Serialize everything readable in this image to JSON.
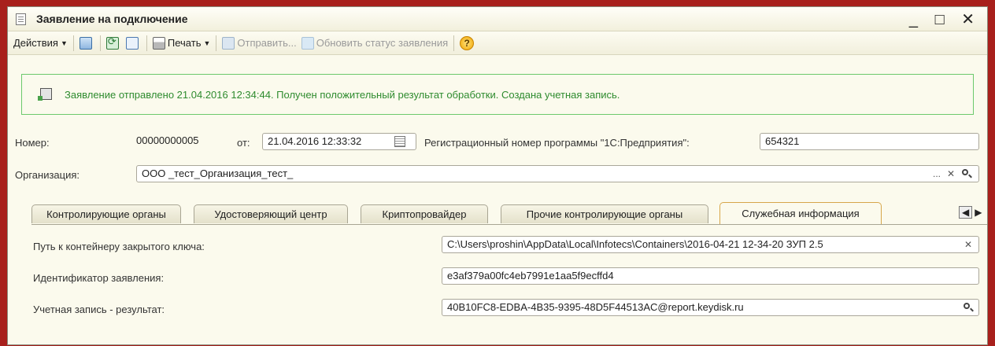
{
  "window": {
    "title": "Заявление на подключение",
    "controls": {
      "minimize": "_",
      "maximize": "□",
      "close": "✕"
    }
  },
  "toolbar": {
    "actions_label": "Действия",
    "print_label": "Печать",
    "send_label": "Отправить...",
    "update_status_label": "Обновить статус заявления",
    "help_label": "?",
    "icons": [
      "save-icon",
      "refresh-icon",
      "copy-icon",
      "printer-icon",
      "send-icon",
      "update-status-icon",
      "help-icon"
    ]
  },
  "notice": {
    "text": "Заявление отправлено 21.04.2016 12:34:44. Получен положительный результат обработки. Создана учетная запись.",
    "color": "#2e8b2e"
  },
  "form": {
    "number_label": "Номер:",
    "number_value": "00000000005",
    "from_label": "от:",
    "date_value": "21.04.2016 12:33:32",
    "regnum_label": "Регистрационный номер программы \"1С:Предприятия\":",
    "regnum_value": "654321",
    "org_label": "Организация:",
    "org_value": "ООО _тест_Организация_тест_",
    "org_buttons": {
      "select": "...",
      "clear": "✕"
    }
  },
  "tabs": [
    {
      "label": "Контролирующие органы"
    },
    {
      "label": "Удостоверяющий центр"
    },
    {
      "label": "Криптопровайдер"
    },
    {
      "label": "Прочие контролирующие органы"
    },
    {
      "label": "Служебная информация"
    }
  ],
  "tab_scroll": {
    "left": "◀",
    "right": "▶"
  },
  "service_info": {
    "key_path_label": "Путь к контейнеру закрытого ключа:",
    "key_path_value": "C:\\Users\\proshin\\AppData\\Local\\Infotecs\\Containers\\2016-04-21 12-34-20 ЗУП 2.5",
    "clear_label": "✕",
    "request_id_label": "Идентификатор заявления:",
    "request_id_value": "e3af379a00fc4eb7991e1aa5f9ecffd4",
    "account_label": "Учетная запись - результат:",
    "account_value": "40B10FC8-EDBA-4B35-9395-48D5F44513AC@report.keydisk.ru"
  },
  "colors": {
    "frame": "#a8201c",
    "window_bg": "#fbfaed",
    "active_tab_border": "#d7a64a"
  }
}
